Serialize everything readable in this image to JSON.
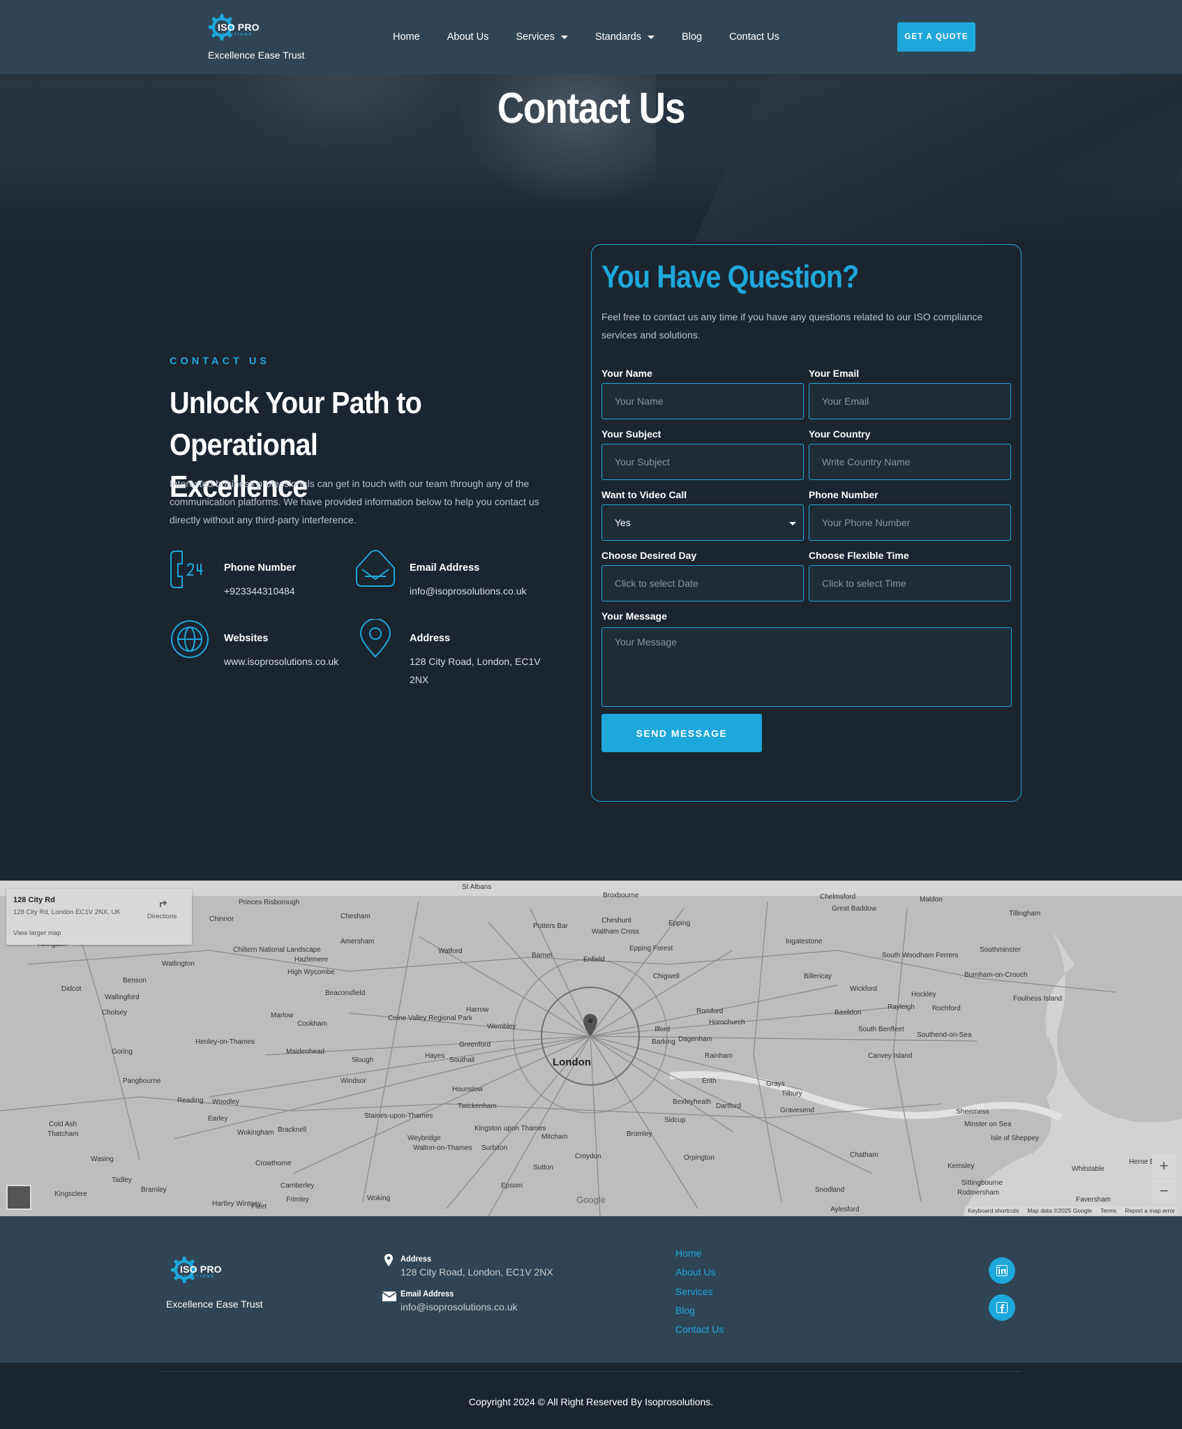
{
  "header": {
    "logo_name": "ISO PRO",
    "logo_sub": "SOLUTIONS",
    "tagline": "Excellence Ease Trust",
    "nav": [
      {
        "label": "Home"
      },
      {
        "label": "About Us"
      },
      {
        "label": "Services",
        "dropdown": true
      },
      {
        "label": "Standards",
        "dropdown": true
      },
      {
        "label": "Blog"
      },
      {
        "label": "Contact Us"
      }
    ],
    "cta": "GET A QUOTE"
  },
  "hero": {
    "title": "Contact Us"
  },
  "contact": {
    "kicker": "CONTACT US",
    "headline": "Unlock Your Path to Operational Excellence",
    "intro": "Interested business professionals can get in touch with our team through any of the communication platforms. We have provided information below to help you contact us directly without any third-party interference.",
    "items": [
      {
        "icon": "phone-24-icon",
        "label": "Phone Number",
        "value": "+923344310484"
      },
      {
        "icon": "mail-inbox-icon",
        "label": "Email Address",
        "value": "info@isoprosolutions.co.uk"
      },
      {
        "icon": "globe-icon",
        "label": "Websites",
        "value": "www.isoprosolutions.co.uk"
      },
      {
        "icon": "map-pin-icon",
        "label": "Address",
        "value": "128 City Road, London, EC1V 2NX"
      }
    ]
  },
  "form": {
    "title": "You Have Question?",
    "description": "Feel free to contact us any time if you have any questions related to our ISO compliance services and solutions.",
    "fields": {
      "name": {
        "label": "Your Name",
        "placeholder": "Your Name"
      },
      "email": {
        "label": "Your Email",
        "placeholder": "Your Email"
      },
      "subject": {
        "label": "Your Subject",
        "placeholder": "Your Subject"
      },
      "country": {
        "label": "Your Country",
        "placeholder": "Write Country Name"
      },
      "video": {
        "label": "Want to Video Call",
        "value": "Yes"
      },
      "phone": {
        "label": "Phone Number",
        "placeholder": "Your Phone Number"
      },
      "day": {
        "label": "Choose Desired Day",
        "placeholder": "Click to select Date"
      },
      "time": {
        "label": "Choose Flexible Time",
        "placeholder": "Click to select Time"
      },
      "message": {
        "label": "Your Message",
        "placeholder": "Your Message"
      }
    },
    "submit": "SEND MESSAGE"
  },
  "map": {
    "card_title": "128 City Rd",
    "card_address": "128 City Rd, London EC1V 2NX, UK",
    "directions": "Directions",
    "larger": "View larger map",
    "zoom_in": "+",
    "zoom_out": "−",
    "attribution": [
      "Keyboard shortcuts",
      "Map data ©2025 Google",
      "Terms",
      "Report a map error"
    ],
    "google": "Google",
    "places": [
      {
        "name": "London"
      },
      {
        "name": "Chelmsford"
      },
      {
        "name": "Maldon"
      },
      {
        "name": "Tillingham"
      },
      {
        "name": "Great Baddow"
      },
      {
        "name": "Southminster"
      },
      {
        "name": "Watford"
      },
      {
        "name": "Barnet"
      },
      {
        "name": "Enfield"
      },
      {
        "name": "Epping"
      },
      {
        "name": "Potters Bar"
      },
      {
        "name": "Chesham"
      },
      {
        "name": "Amersham"
      },
      {
        "name": "High Wycombe"
      },
      {
        "name": "Harrow"
      },
      {
        "name": "Wembley"
      },
      {
        "name": "Romford"
      },
      {
        "name": "Basildon"
      },
      {
        "name": "Southend-on-Sea"
      },
      {
        "name": "Slough"
      },
      {
        "name": "Windsor"
      },
      {
        "name": "Reading"
      },
      {
        "name": "Woking"
      },
      {
        "name": "Croydon"
      },
      {
        "name": "Bromley"
      },
      {
        "name": "Dartford"
      },
      {
        "name": "Gravesend"
      },
      {
        "name": "Chatham"
      },
      {
        "name": "Sidcup"
      },
      {
        "name": "Sutton"
      },
      {
        "name": "Epsom"
      },
      {
        "name": "Twickenham"
      },
      {
        "name": "Hounslow"
      },
      {
        "name": "Maidenhead"
      },
      {
        "name": "Marlow"
      },
      {
        "name": "Wokingham"
      },
      {
        "name": "Bracknell"
      },
      {
        "name": "Ilford"
      },
      {
        "name": "Chigwell"
      },
      {
        "name": "Billericay"
      },
      {
        "name": "Wickford"
      },
      {
        "name": "Rayleigh"
      },
      {
        "name": "Rochford"
      },
      {
        "name": "Canvey Island"
      },
      {
        "name": "Tilbury"
      },
      {
        "name": "Grays"
      },
      {
        "name": "Rainham"
      },
      {
        "name": "Orpington"
      },
      {
        "name": "Sheerness"
      },
      {
        "name": "Sittingbourne"
      },
      {
        "name": "Whitstable"
      },
      {
        "name": "Faversham"
      },
      {
        "name": "Snodland"
      },
      {
        "name": "Aylesford"
      },
      {
        "name": "Kingsclere"
      },
      {
        "name": "Didcot"
      },
      {
        "name": "Wallingford"
      },
      {
        "name": "Benson"
      },
      {
        "name": "Watlington"
      },
      {
        "name": "Goring"
      },
      {
        "name": "Pangbourne"
      },
      {
        "name": "Thatcham"
      },
      {
        "name": "Tadley"
      },
      {
        "name": "Crowthorne"
      },
      {
        "name": "Camberley"
      },
      {
        "name": "Hartley Wintney"
      },
      {
        "name": "Bramley"
      },
      {
        "name": "Abingdon"
      },
      {
        "name": "Cholsey"
      },
      {
        "name": "Henley-on-Thames"
      },
      {
        "name": "Beaconsfield"
      },
      {
        "name": "Hayes"
      },
      {
        "name": "Southall"
      },
      {
        "name": "Greenford"
      },
      {
        "name": "Staines-upon-Thames"
      },
      {
        "name": "Weybridge"
      },
      {
        "name": "Walton-on-Thames"
      },
      {
        "name": "Mitcham"
      },
      {
        "name": "Kingston upon Thames"
      },
      {
        "name": "Dagenham"
      },
      {
        "name": "Barking"
      },
      {
        "name": "Hornchurch"
      },
      {
        "name": "Erith"
      },
      {
        "name": "Bexleyheath"
      },
      {
        "name": "Ingatestone"
      },
      {
        "name": "Waltham Cross"
      },
      {
        "name": "Cheshunt"
      },
      {
        "name": "St Albans"
      },
      {
        "name": "Princes Risborough"
      },
      {
        "name": "Chinnor"
      },
      {
        "name": "Hazlemere"
      },
      {
        "name": "Cookham"
      },
      {
        "name": "Woodley"
      },
      {
        "name": "Earley"
      },
      {
        "name": "Wasing"
      },
      {
        "name": "Cold Ash"
      },
      {
        "name": "Fleet"
      },
      {
        "name": "Burnham-on-Crouch"
      },
      {
        "name": "Foulness Island"
      },
      {
        "name": "Hockley"
      },
      {
        "name": "South Woodham Ferrers"
      },
      {
        "name": "South Benfleet"
      },
      {
        "name": "Minster on Sea"
      },
      {
        "name": "Isle of Sheppey"
      },
      {
        "name": "Kemsley"
      },
      {
        "name": "Rodmersham"
      },
      {
        "name": "Herne Bay"
      },
      {
        "name": "Broxbourne"
      },
      {
        "name": "Epping Forest"
      },
      {
        "name": "Chiltern National Landscape"
      },
      {
        "name": "Colne Valley Regional Park"
      },
      {
        "name": "Frimley"
      },
      {
        "name": "Surbiton"
      }
    ]
  },
  "footer": {
    "logo_name": "ISO PRO",
    "logo_sub": "SOLUTIONS",
    "tagline": "Excellence Ease Trust",
    "address_label": "Address",
    "address": "128 City Road, London, EC1V 2NX",
    "email_label": "Email Address",
    "email": "info@isoprosolutions.co.uk",
    "links": [
      "Home",
      "About Us",
      "Services",
      "Blog",
      "Contact Us"
    ],
    "social": [
      "linkedin-icon",
      "facebook-icon"
    ],
    "copyright": "Copyright 2024 © All Right Reserved By Isoprosolutions."
  },
  "colors": {
    "accent": "#1ea7db",
    "header_bg": "#2f4555",
    "page_bg": "#1b2530"
  }
}
